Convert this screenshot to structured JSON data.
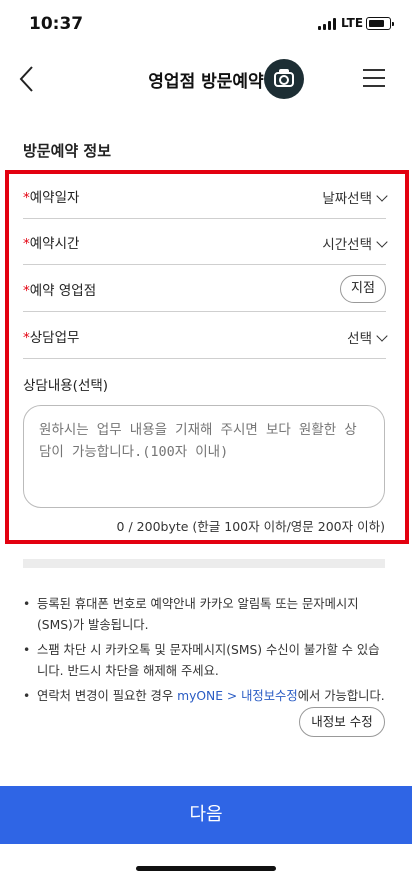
{
  "status": {
    "time": "10:37",
    "network": "LTE"
  },
  "header": {
    "title": "영업점 방문예약"
  },
  "section_title": "방문예약 정보",
  "form": {
    "date": {
      "label": "예약일자",
      "value": "날짜선택"
    },
    "time": {
      "label": "예약시간",
      "value": "시간선택"
    },
    "branch": {
      "label": "예약 영업점",
      "button": "지점"
    },
    "consult": {
      "label": "상담업무",
      "value": "선택"
    },
    "content": {
      "label": "상담내용(선택)",
      "placeholder": "원하시는 업무 내용을 기재해 주시면 보다 원활한 상담이 가능합니다.(100자 이내)",
      "counter": "0 / 200byte (한글 100자 이하/영문 200자 이하)"
    }
  },
  "notices": [
    "등록된 휴대폰 번호로 예약안내 카카오 알림톡 또는 문자메시지(SMS)가 발송됩니다.",
    "스팸 차단 시 카카오톡 및 문자메시지(SMS) 수신이 불가할 수 있습니다. 반드시 차단을 해제해 주세요."
  ],
  "contact_notice": {
    "prefix": "연락처 변경이 필요한 경우 ",
    "link": "myONE > 내정보수정",
    "suffix": "에서 가능합니다."
  },
  "edit_info_button": "내정보 수정",
  "next_button": "다음"
}
